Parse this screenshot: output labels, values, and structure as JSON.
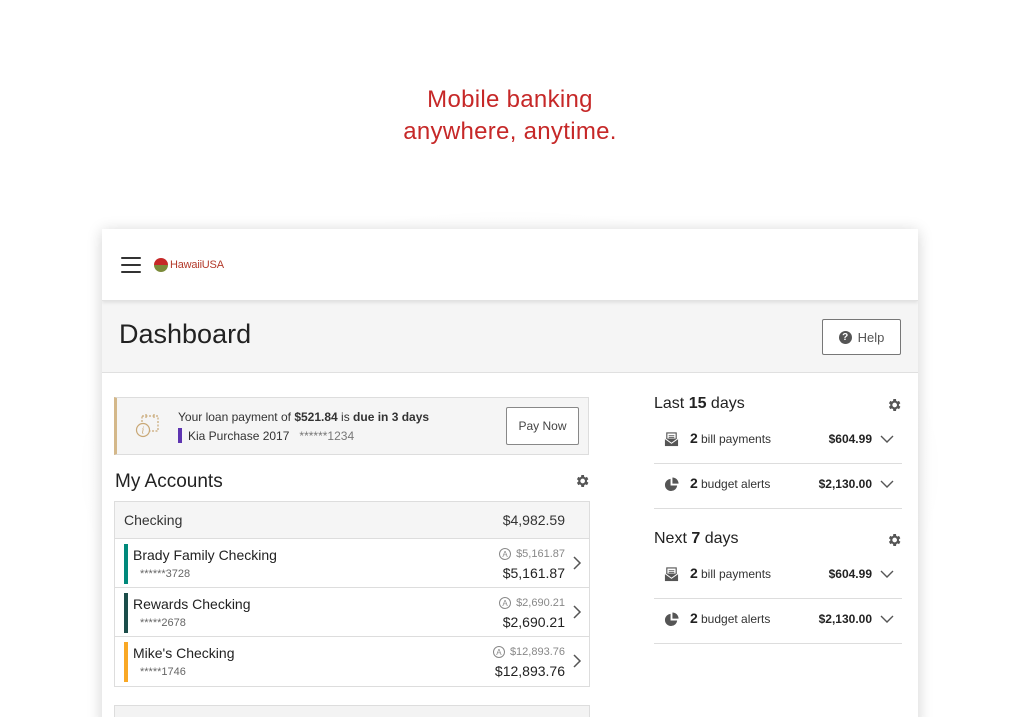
{
  "headline": {
    "line1": "Mobile banking",
    "line2": "anywhere, anytime."
  },
  "colors": {
    "headline": "#c62828",
    "brady": "#00897b",
    "rewards": "#1b4d4a",
    "mikes": "#f9a825",
    "kia": "#5e35b1"
  },
  "app": {
    "logo_text": "HawaiiUSA",
    "menu_icon": "hamburger-menu-icon"
  },
  "page": {
    "title": "Dashboard",
    "help_label": "Help"
  },
  "alert": {
    "prefix": "Your loan payment of ",
    "amount": "$521.84",
    "middle": " is ",
    "due": "due in 3 days",
    "loan_name": "Kia Purchase 2017",
    "loan_number": "******1234",
    "pay_label": "Pay Now"
  },
  "accounts": {
    "title": "My Accounts",
    "group": {
      "name": "Checking",
      "total": "$4,982.59"
    },
    "items": [
      {
        "name": "Brady Family Checking",
        "number": "******3728",
        "available": "$5,161.87",
        "balance": "$5,161.87"
      },
      {
        "name": "Rewards Checking",
        "number": "*****2678",
        "available": "$2,690.21",
        "balance": "$2,690.21"
      },
      {
        "name": "Mike's Checking",
        "number": "*****1746",
        "available": "$12,893.76",
        "balance": "$12,893.76"
      }
    ],
    "available_badge": "A"
  },
  "last_days": {
    "pre": "Last ",
    "num": "15",
    "post": " days",
    "rows": [
      {
        "count": "2",
        "label": "bill payments",
        "amount": "$604.99",
        "icon": "bill-icon"
      },
      {
        "count": "2",
        "label": "budget alerts",
        "amount": "$2,130.00",
        "icon": "pie-chart-icon"
      }
    ]
  },
  "next_days": {
    "pre": "Next ",
    "num": "7",
    "post": " days",
    "rows": [
      {
        "count": "2",
        "label": "bill payments",
        "amount": "$604.99",
        "icon": "bill-icon"
      },
      {
        "count": "2",
        "label": "budget alerts",
        "amount": "$2,130.00",
        "icon": "pie-chart-icon"
      }
    ]
  }
}
